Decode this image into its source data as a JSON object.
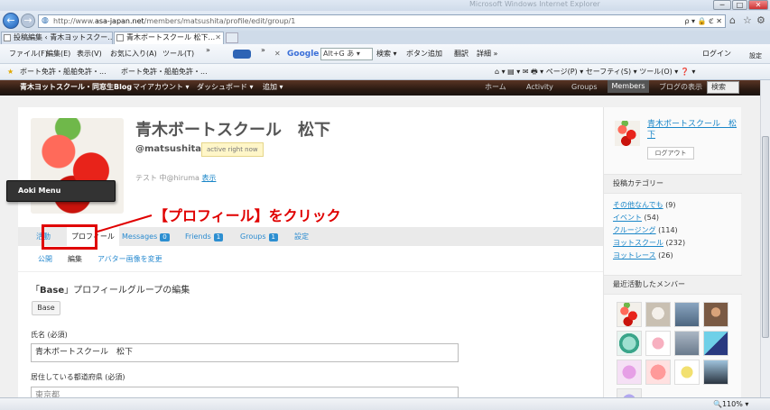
{
  "window": {
    "title": "Microsoft Windows Internet Explorer",
    "controls": [
      "─",
      "□",
      "✕"
    ]
  },
  "address": {
    "url_prefix": "http://www.",
    "url_host": "asa-japan.net",
    "url_path": "/members/matsushita/profile/edit/group/1",
    "tools": "ρ ▾ 🔒 ℭ ✕",
    "right_icons": [
      "⌂",
      "☆",
      "⚙"
    ]
  },
  "tabs": [
    {
      "label": "投稿編集 ‹ 青木ヨットスクー...",
      "active": false
    },
    {
      "label": "青木ボートスクール 松下...",
      "active": true
    }
  ],
  "menubar": {
    "items": [
      "ファイル(F)",
      "編集(E)",
      "表示(V)",
      "お気に入り(A)",
      "ツール(T)"
    ],
    "chevron": "»",
    "google_label": "Google",
    "search_value": "Alt+G あ ▾",
    "search_btn": "検索 ▾",
    "addon_btn": "ボタン追加",
    "translate_btn": "翻訳",
    "detail_btn": "詳細 »",
    "login_btn": "ログイン",
    "settings_btn": "設定"
  },
  "favbar": {
    "items": [
      "ボート免許・船舶免許・...",
      "ボート免許・船舶免許・..."
    ],
    "right": "⌂ ▾  ▤ ▾  ✉  🖶 ▾  ページ(P) ▾  セーフティ(S) ▾  ツール(O) ▾  ❓ ▾"
  },
  "sitenav": {
    "left": [
      "青木ヨットスクール・同窓生Blog",
      "マイアカウント ▾",
      "ダッシュボード ▾",
      "追加 ▾"
    ],
    "right": [
      "ホーム",
      "Activity",
      "Groups",
      "Members",
      "ブログの表示"
    ],
    "search": "検索"
  },
  "profile": {
    "name": "青木ボートスクール　松下",
    "handle": "@matsushita",
    "active": "active right now",
    "status": "テスト 中@hiruma",
    "status_link": "表示"
  },
  "subnav": {
    "items": [
      "活動",
      "プロフィール",
      "Messages",
      "Friends",
      "Groups",
      "設定"
    ],
    "counts": {
      "messages": "0",
      "friends": "1",
      "groups": "1"
    }
  },
  "subsub": {
    "items": [
      "公開",
      "編集",
      "アバター画像を変更"
    ]
  },
  "form": {
    "title_quote_open": "「",
    "title_bold": "Base",
    "title_rest": "」プロフィールグループの編集",
    "group_btn": "Base",
    "name_label": "氏名 (必須)",
    "name_value": "青木ボートスクール　松下",
    "pref_label": "居住している都道府県 (必須)",
    "pref_value": "東京都"
  },
  "sidebar": {
    "user_name": "青木ボートスクール　松下",
    "logout": "ログアウト",
    "cat_title": "投稿カテゴリー",
    "categories": [
      {
        "name": "その他なんでも",
        "count": "(9)"
      },
      {
        "name": "イベント",
        "count": "(54)"
      },
      {
        "name": "クルージング",
        "count": "(114)"
      },
      {
        "name": "ヨットスクール",
        "count": "(232)"
      },
      {
        "name": "ヨットレース",
        "count": "(26)"
      }
    ],
    "members_title": "最近活動したメンバー"
  },
  "overlay": {
    "aoki_menu": "Aoki Menu",
    "callout": "【プロフィール】をクリック"
  },
  "status": {
    "zoom": "🔍110%  ▾"
  },
  "colors": {
    "accent_link": "#1a86c8",
    "annotation": "#e00000",
    "badge": "#2d8fd1"
  }
}
